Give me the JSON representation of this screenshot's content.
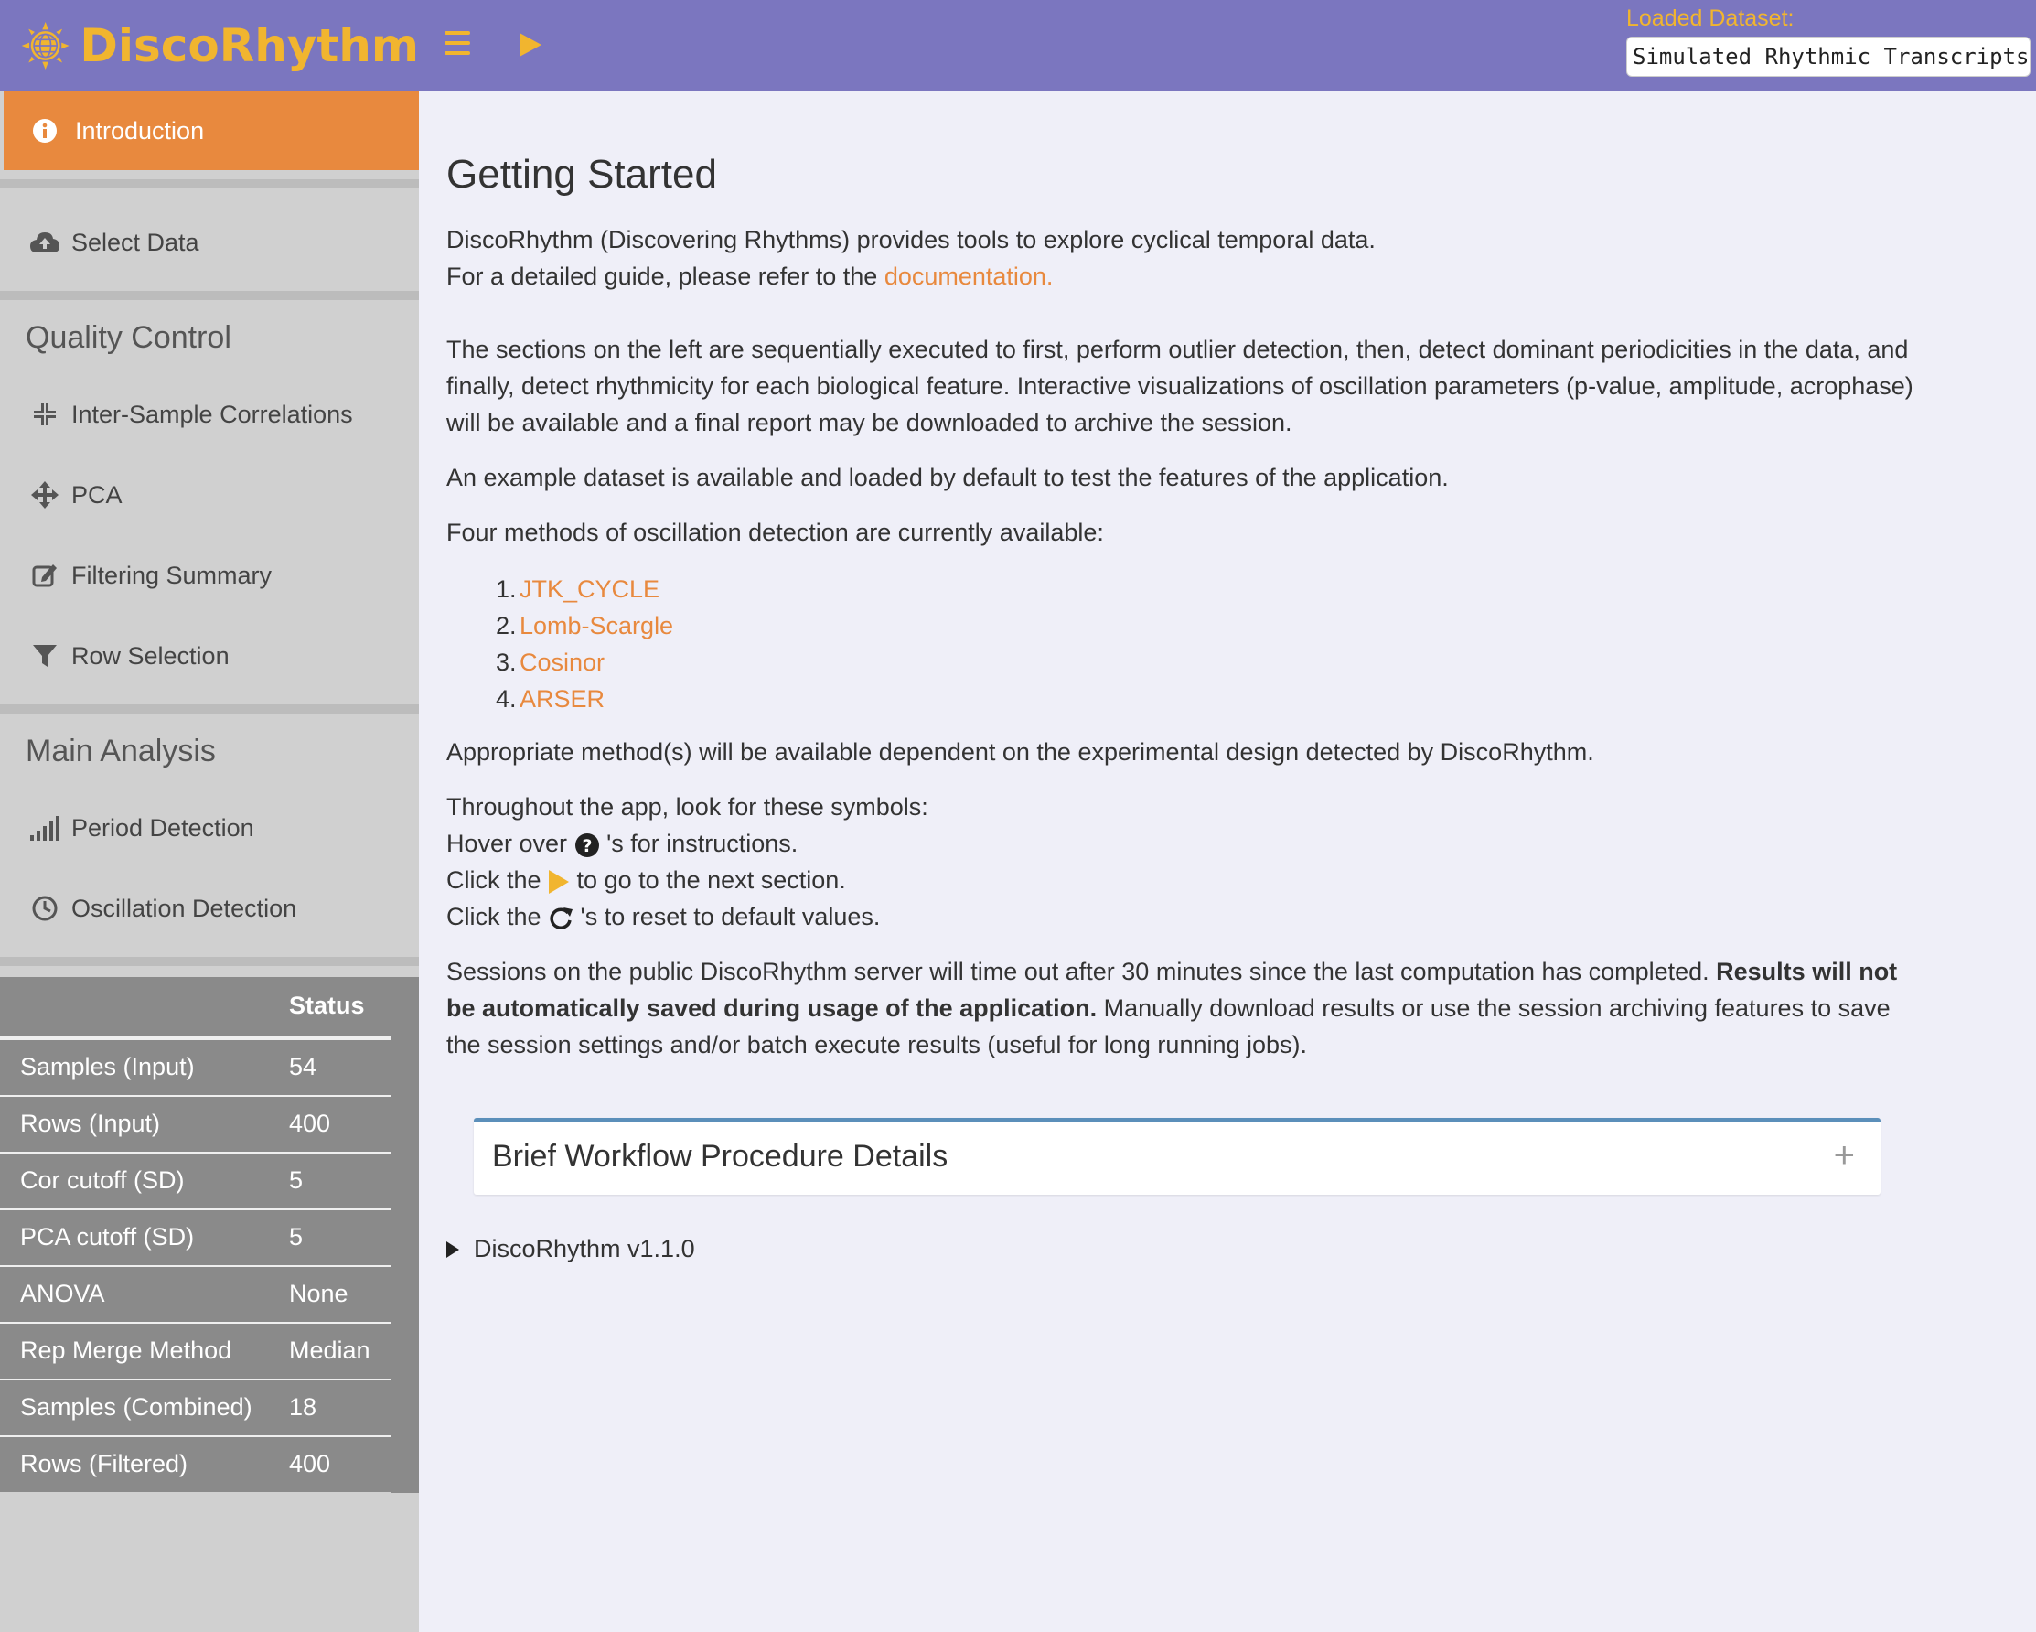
{
  "header": {
    "app_name": "DiscoRhythm",
    "loaded_label": "Loaded Dataset:",
    "loaded_value": "Simulated Rhythmic Transcripts"
  },
  "sidebar": {
    "active": "Introduction",
    "select_data": "Select Data",
    "qc_heading": "Quality Control",
    "qc_items": [
      "Inter-Sample Correlations",
      "PCA",
      "Filtering Summary",
      "Row Selection"
    ],
    "main_heading": "Main Analysis",
    "main_items": [
      "Period Detection",
      "Oscillation Detection"
    ]
  },
  "status": {
    "header": "Status",
    "rows": [
      {
        "key": "Samples (Input)",
        "value": "54"
      },
      {
        "key": "Rows (Input)",
        "value": "400"
      },
      {
        "key": "Cor cutoff (SD)",
        "value": "5"
      },
      {
        "key": "PCA cutoff (SD)",
        "value": "5"
      },
      {
        "key": "ANOVA",
        "value": "None"
      },
      {
        "key": "Rep Merge Method",
        "value": "Median"
      },
      {
        "key": "Samples (Combined)",
        "value": "18"
      },
      {
        "key": "Rows (Filtered)",
        "value": "400"
      }
    ]
  },
  "main": {
    "title": "Getting Started",
    "intro1": "DiscoRhythm (Discovering Rhythms) provides tools to explore cyclical temporal data.",
    "intro2_pre": "For a detailed guide, please refer to the ",
    "intro2_link": "documentation.",
    "sections_text": "The sections on the left are sequentially executed to first, perform outlier detection, then, detect dominant periodicities in the data, and finally, detect rhythmicity for each biological feature. Interactive visualizations of oscillation parameters (p-value, amplitude, acrophase) will be available and a final report may be downloaded to archive the session.",
    "example_text": "An example dataset is available and loaded by default to test the features of the application.",
    "methods_intro": "Four methods of oscillation detection are currently available:",
    "methods": [
      "JTK_CYCLE",
      "Lomb-Scargle",
      "Cosinor",
      "ARSER"
    ],
    "appropriate_text": "Appropriate method(s) will be available dependent on the experimental design detected by DiscoRhythm.",
    "symbols_intro": "Throughout the app, look for these symbols:",
    "hover_pre": "Hover over ",
    "hover_post": " 's for instructions.",
    "click1_pre": "Click the ",
    "click1_post": " to go to the next section.",
    "click2_pre": "Click the ",
    "click2_post": " 's to reset to default values.",
    "session_text1": "Sessions on the public DiscoRhythm server will time out after 30 minutes since the last computation has completed. ",
    "session_bold": "Results will not be automatically saved during usage of the application.",
    "session_text2": " Manually download results or use the session archiving features to save the session settings and/or batch execute results (useful for long running jobs).",
    "card_title": "Brief Workflow Procedure Details",
    "version": "DiscoRhythm v1.1.0"
  }
}
